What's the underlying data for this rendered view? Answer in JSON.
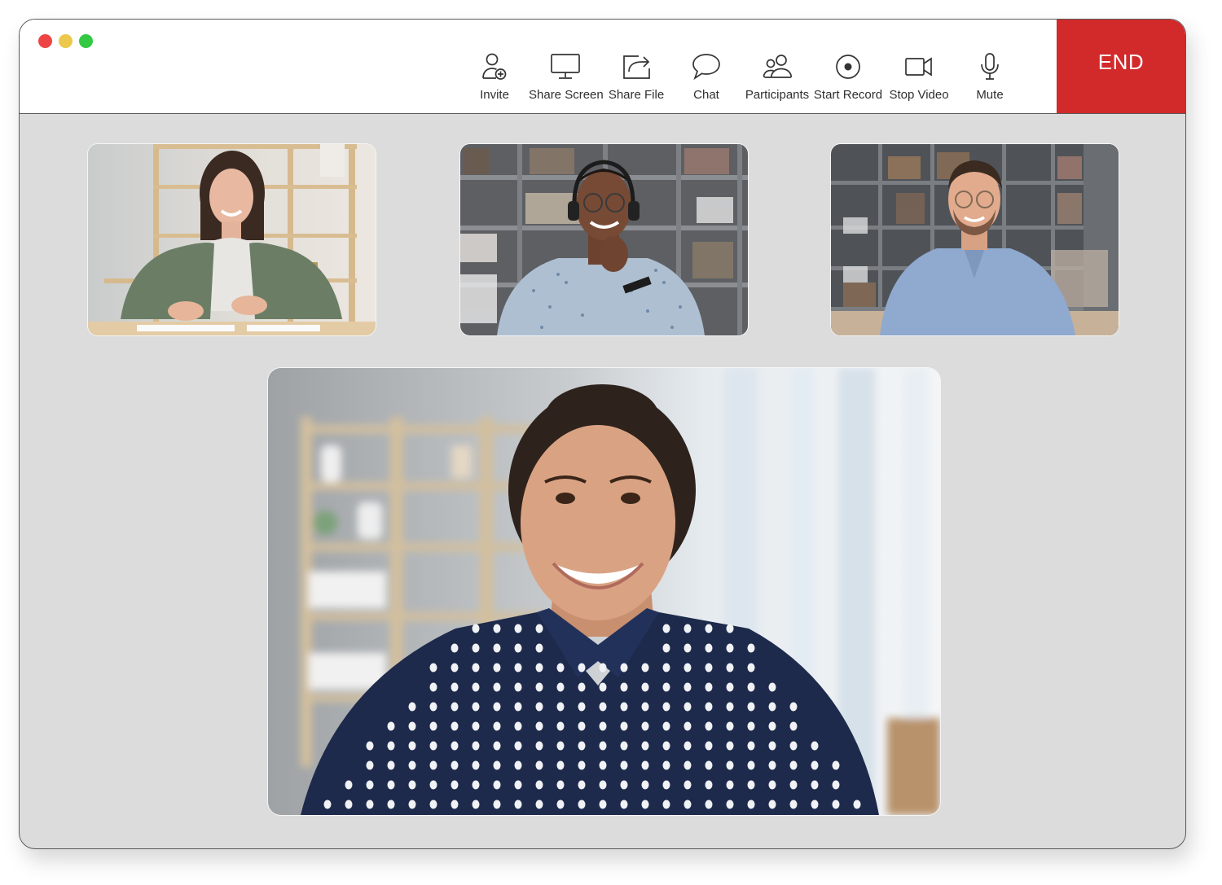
{
  "window": {
    "traffic_lights": [
      "close",
      "minimize",
      "maximize"
    ],
    "colors": {
      "close": "#ed4545",
      "minimize": "#ecc94b",
      "maximize": "#34c943"
    }
  },
  "toolbar": {
    "items": [
      {
        "id": "invite",
        "label": "Invite",
        "icon": "user-plus-icon"
      },
      {
        "id": "share-screen",
        "label": "Share Screen",
        "icon": "monitor-icon"
      },
      {
        "id": "share-file",
        "label": "Share File",
        "icon": "share-arrow-icon"
      },
      {
        "id": "chat",
        "label": "Chat",
        "icon": "speech-bubble-icon"
      },
      {
        "id": "participants",
        "label": "Participants",
        "icon": "users-icon"
      },
      {
        "id": "start-record",
        "label": "Start Record",
        "icon": "record-icon"
      },
      {
        "id": "stop-video",
        "label": "Stop Video",
        "icon": "video-camera-icon"
      },
      {
        "id": "mute",
        "label": "Mute",
        "icon": "microphone-icon"
      }
    ],
    "end_label": "END",
    "end_color": "#d2292b"
  },
  "participants": [
    {
      "tile": "participant-1",
      "description": "Woman in green cardigan at desk, wooden shelves behind"
    },
    {
      "tile": "participant-2",
      "description": "Man with headset and glasses, bookshelf behind"
    },
    {
      "tile": "participant-3",
      "description": "Man with glasses in light blue shirt, bookshelf behind"
    },
    {
      "tile": "active-speaker",
      "description": "Smiling woman in navy polka-dot blouse, window with curtains behind"
    }
  ]
}
